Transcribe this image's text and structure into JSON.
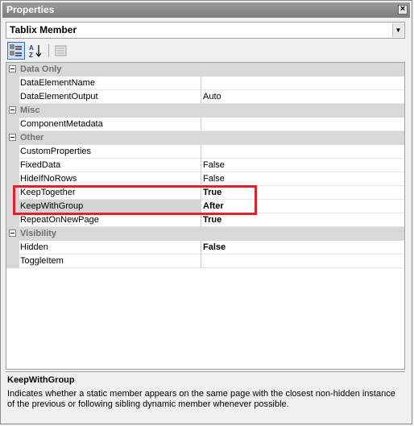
{
  "window": {
    "title": "Properties",
    "close_glyph": "×"
  },
  "object_selector": {
    "value": "Tablix Member"
  },
  "toolbar": {
    "buttons": [
      {
        "name": "categorized-icon",
        "active": true
      },
      {
        "name": "alphabetical-icon",
        "active": false
      },
      {
        "name": "property-pages-icon",
        "active": false
      }
    ]
  },
  "grid": {
    "categories": [
      {
        "label": "Data Only",
        "properties": [
          {
            "name": "DataElementName",
            "value": "",
            "bold": false
          },
          {
            "name": "DataElementOutput",
            "value": "Auto",
            "bold": false
          }
        ]
      },
      {
        "label": "Misc",
        "properties": [
          {
            "name": "ComponentMetadata",
            "value": "",
            "bold": false
          }
        ]
      },
      {
        "label": "Other",
        "properties": [
          {
            "name": "CustomProperties",
            "value": "",
            "bold": false
          },
          {
            "name": "FixedData",
            "value": "False",
            "bold": false
          },
          {
            "name": "HideIfNoRows",
            "value": "False",
            "bold": false
          },
          {
            "name": "KeepTogether",
            "value": "True",
            "bold": true
          },
          {
            "name": "KeepWithGroup",
            "value": "After",
            "bold": true,
            "selected": true
          },
          {
            "name": "RepeatOnNewPage",
            "value": "True",
            "bold": true
          }
        ]
      },
      {
        "label": "Visibility",
        "properties": [
          {
            "name": "Hidden",
            "value": "False",
            "bold": true
          },
          {
            "name": "ToggleItem",
            "value": "",
            "bold": false
          }
        ]
      }
    ]
  },
  "help": {
    "title": "KeepWithGroup",
    "description": "Indicates whether a static member appears on the same page with the closest non-hidden instance of the previous or following sibling dynamic member whenever possible."
  },
  "colors": {
    "highlight_box": "#e0202a",
    "category_bg": "#d8d8d8"
  }
}
